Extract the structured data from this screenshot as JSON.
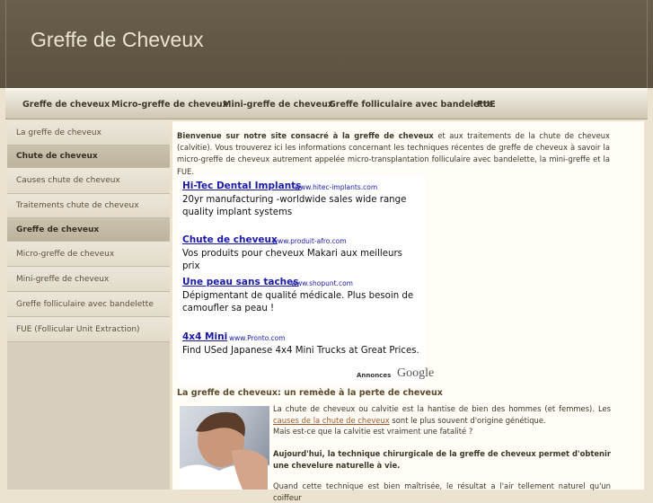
{
  "site": {
    "title": "Greffe de Cheveux"
  },
  "nav": [
    {
      "label": "Greffe de cheveux"
    },
    {
      "label": "Micro-greffe de cheveux"
    },
    {
      "label": "Mini-greffe de cheveux"
    },
    {
      "label": "Greffe folliculaire avec bandelette"
    },
    {
      "label": "FUE"
    }
  ],
  "sidebar": [
    {
      "label": "La greffe de cheveux",
      "type": "link"
    },
    {
      "label": "Chute de cheveux",
      "type": "header"
    },
    {
      "label": "Causes chute de cheveux",
      "type": "link"
    },
    {
      "label": "Traitements chute de cheveux",
      "type": "link"
    },
    {
      "label": "Greffe de cheveux",
      "type": "header"
    },
    {
      "label": "Micro-greffe de cheveux",
      "type": "link"
    },
    {
      "label": "Mini-greffe de cheveux",
      "type": "link"
    },
    {
      "label": "Greffe folliculaire avec bandelette",
      "type": "link"
    },
    {
      "label": "FUE (Follicular Unit Extraction)",
      "type": "link"
    }
  ],
  "intro": {
    "bold": "Bienvenue sur notre site consacré à la greffe de cheveux",
    "text": " et aux traitements de la chute de cheveux (calvitie). Vous trouverez ici les informations concernant les techniques récentes de greffe de cheveux à savoir la micro-greffe de cheveux autrement appelée micro-transplantation folliculaire avec bandelette, la mini-greffe et la FUE."
  },
  "ads": [
    {
      "title": "Hi-Tec Dental Implants",
      "url": "www.hitec-implants.com",
      "desc": "20yr manufacturing -worldwide sales wide range quality implant systems"
    },
    {
      "title": "Chute de cheveux",
      "url": "www.produit-afro.com",
      "desc": "Vos produits pour cheveux Makari aux meilleurs prix"
    },
    {
      "title": "Une peau sans taches",
      "url": "www.shopunt.com",
      "desc": "Dépigmentant de qualité médicale. Plus besoin de camoufler sa peau !"
    },
    {
      "title": "4x4 Mini",
      "url": "www.Pronto.com",
      "desc": "Find USed Japanese 4x4 Mini Trucks at Great Prices."
    }
  ],
  "ads_choice": "Annonces",
  "ads_brand": "Google",
  "article": {
    "title": "La greffe de cheveux: un remède à la perte de cheveux",
    "p1_a": "La chute de cheveux ou calvitie est la hantise de bien des hommes (et femmes). Les ",
    "p1_link": "causes de la chute de cheveux",
    "p1_b": " sont le plus souvent d'origine génétique.",
    "p2": "Mais est-ce que la calvitie est vraiment une fatalité ?",
    "p3": "Aujourd'hui, la technique chirurgicale de la greffe de cheveux permet d'obtenir une chevelure naturelle à vie.",
    "p4": "Quand cette technique est bien maîtrisée, le résultat a l'air tellement naturel qu'un coiffeur"
  }
}
